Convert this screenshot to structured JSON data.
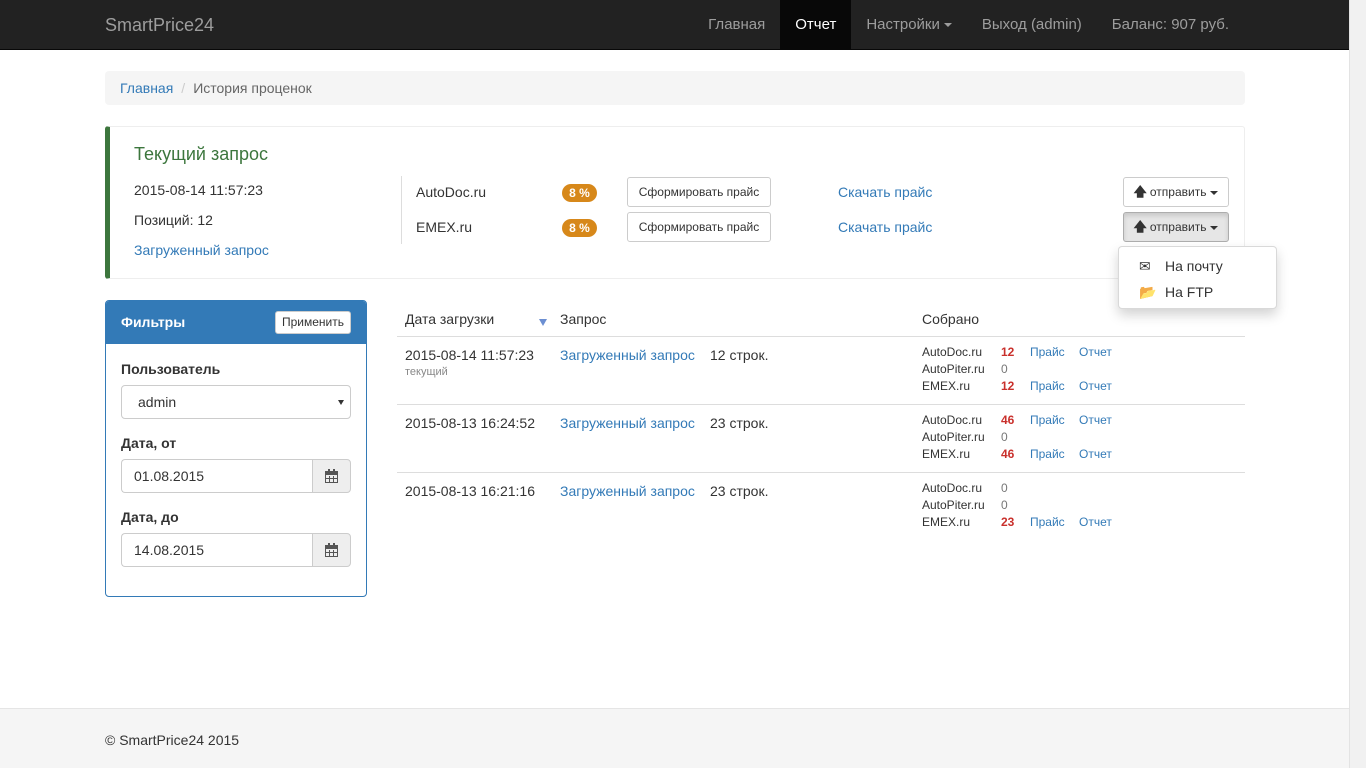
{
  "navbar": {
    "brand": "SmartPrice24",
    "items": [
      {
        "label": "Главная"
      },
      {
        "label": "Отчет",
        "active": true
      },
      {
        "label": "Настройки"
      },
      {
        "label": "Выход (admin)"
      },
      {
        "label": "Баланс: 907 руб."
      }
    ]
  },
  "breadcrumb": {
    "home": "Главная",
    "separator": "/",
    "current": "История проценок"
  },
  "current_request": {
    "title": "Текущий запрос",
    "datetime": "2015-08-14 11:57:23",
    "positions": "Позиций: 12",
    "loaded_link": "Загруженный запрос",
    "sources": [
      {
        "name": "AutoDoc.ru",
        "percent": "8 %",
        "form_button": "Сформировать прайс",
        "download_link": "Скачать прайс",
        "send_button": "отправить"
      },
      {
        "name": "EMEX.ru",
        "percent": "8 %",
        "form_button": "Сформировать прайс",
        "download_link": "Скачать прайс",
        "send_button": "отправить"
      }
    ],
    "send_menu": {
      "items": [
        {
          "icon": "envelope-icon",
          "label": "На почту"
        },
        {
          "icon": "folder-open-icon",
          "label": "На FTP"
        }
      ]
    }
  },
  "filters": {
    "title": "Фильтры",
    "apply_button": "Применить",
    "user_label": "Пользователь",
    "user_value": "admin",
    "date_from_label": "Дата, от",
    "date_from_value": "01.08.2015",
    "date_to_label": "Дата, до",
    "date_to_value": "14.08.2015"
  },
  "history": {
    "headers": {
      "date": "Дата загрузки",
      "request": "Запрос",
      "collected": "Собрано"
    },
    "rows": [
      {
        "date": "2015-08-14 11:57:23",
        "note": "текущий",
        "request_link": "Загруженный запрос",
        "lines": "12 строк.",
        "collected": [
          {
            "site": "AutoDoc.ru",
            "count": "12",
            "price": "Прайс",
            "report": "Отчет"
          },
          {
            "site": "AutoPiter.ru",
            "count": "0",
            "price": "",
            "report": ""
          },
          {
            "site": "EMEX.ru",
            "count": "12",
            "price": "Прайс",
            "report": "Отчет"
          }
        ]
      },
      {
        "date": "2015-08-13 16:24:52",
        "note": "",
        "request_link": "Загруженный запрос",
        "lines": "23 строк.",
        "collected": [
          {
            "site": "AutoDoc.ru",
            "count": "46",
            "price": "Прайс",
            "report": "Отчет"
          },
          {
            "site": "AutoPiter.ru",
            "count": "0",
            "price": "",
            "report": ""
          },
          {
            "site": "EMEX.ru",
            "count": "46",
            "price": "Прайс",
            "report": "Отчет"
          }
        ]
      },
      {
        "date": "2015-08-13 16:21:16",
        "note": "",
        "request_link": "Загруженный запрос",
        "lines": "23 строк.",
        "collected": [
          {
            "site": "AutoDoc.ru",
            "count": "0",
            "price": "",
            "report": ""
          },
          {
            "site": "AutoPiter.ru",
            "count": "0",
            "price": "",
            "report": ""
          },
          {
            "site": "EMEX.ru",
            "count": "23",
            "price": "Прайс",
            "report": "Отчет"
          }
        ]
      }
    ]
  },
  "footer": {
    "text": "© SmartPrice24 2015"
  },
  "colors": {
    "navbar": "#222222",
    "link": "#337ab7",
    "accent_green": "#3c763d",
    "badge": "#d7881a",
    "count_red": "#c9302c"
  }
}
